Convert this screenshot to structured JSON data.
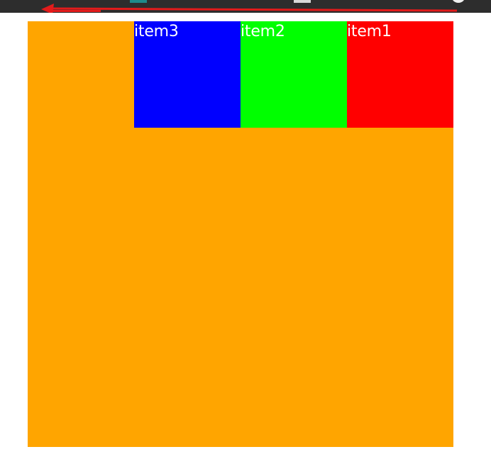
{
  "colors": {
    "container": "#ffa500",
    "item3": "#0000ff",
    "item2": "#00ff00",
    "item1": "#ff0000",
    "top_bar": "#2d2d2d",
    "annotation_arrow": "#e21b1b"
  },
  "items": [
    {
      "label": "item3"
    },
    {
      "label": "item2"
    },
    {
      "label": "item1"
    }
  ]
}
